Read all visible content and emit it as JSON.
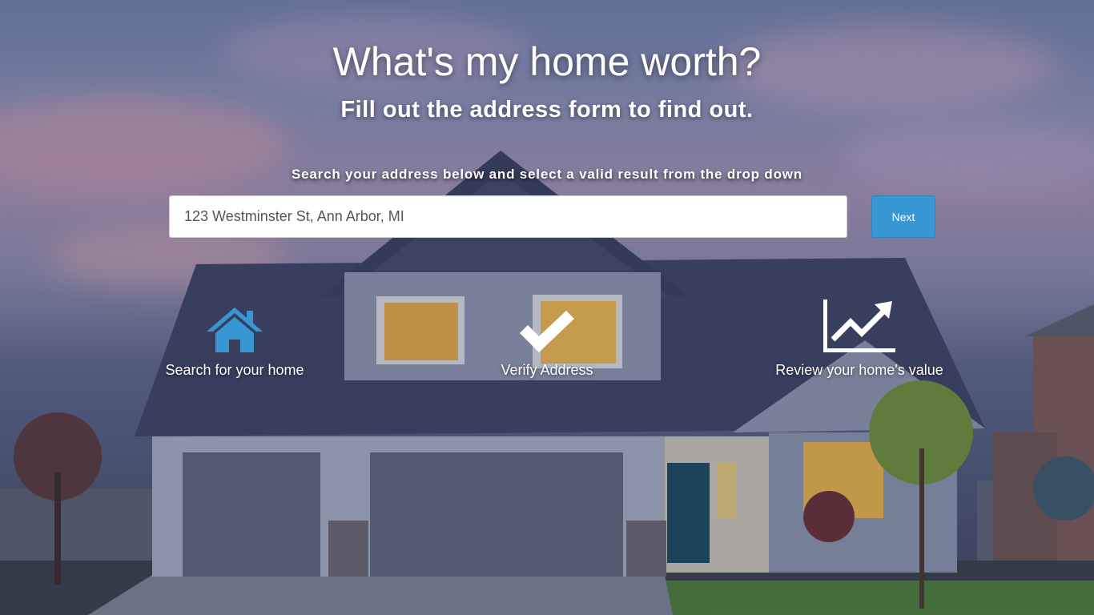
{
  "hero": {
    "title": "What's my home worth?",
    "subtitle": "Fill out the address form to find out."
  },
  "search": {
    "instruction": "Search your address below and select a valid result from the drop down",
    "placeholder": "123 Westminster St, Ann Arbor, MI",
    "next_label": "Next"
  },
  "steps": [
    {
      "label": "Search for your home",
      "icon": "house-icon",
      "color": "#3897d3"
    },
    {
      "label": "Verify Address",
      "icon": "checkmark-icon",
      "color": "#ffffff"
    },
    {
      "label": "Review your home's value",
      "icon": "chart-trend-icon",
      "color": "#ffffff"
    }
  ],
  "colors": {
    "accent": "#3897d3",
    "text": "#ffffff"
  }
}
